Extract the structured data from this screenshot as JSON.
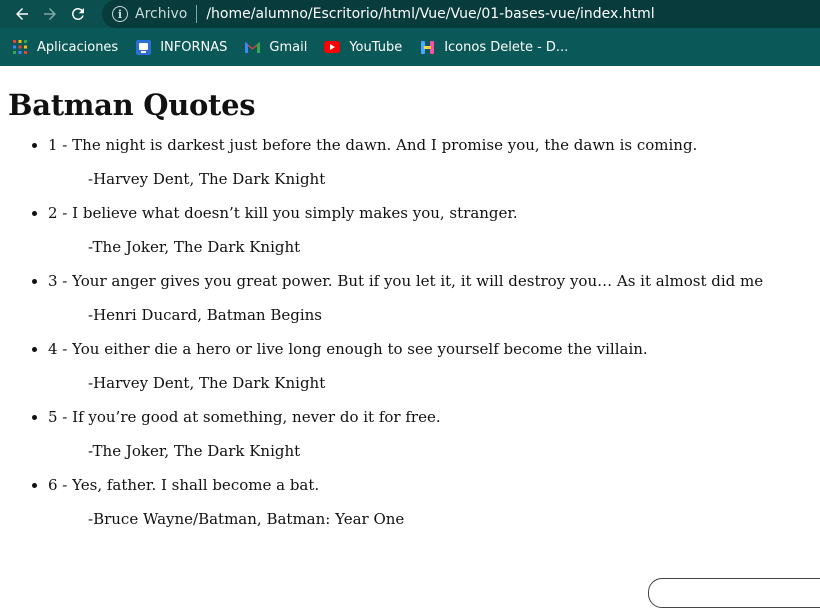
{
  "browser": {
    "archivo_label": "Archivo",
    "url": "/home/alumno/Escritorio/html/Vue/Vue/01-bases-vue/index.html",
    "bookmarks": [
      {
        "label": "Aplicaciones",
        "icon": "apps-grid-icon"
      },
      {
        "label": "INFORNAS",
        "icon": "infornas-icon"
      },
      {
        "label": "Gmail",
        "icon": "gmail-icon"
      },
      {
        "label": "YouTube",
        "icon": "youtube-icon"
      },
      {
        "label": "Iconos Delete - D...",
        "icon": "iconos-delete-icon"
      }
    ]
  },
  "page": {
    "title": "Batman Quotes",
    "quotes": [
      {
        "text": "1 - The night is darkest just before the dawn. And I promise you, the dawn is coming.",
        "author": "-Harvey Dent, The Dark Knight"
      },
      {
        "text": "2 - I believe what doesn’t kill you simply makes you, stranger.",
        "author": "-The Joker, The Dark Knight"
      },
      {
        "text": "3 - Your anger gives you great power. But if you let it, it will destroy you… As it almost did me",
        "author": "-Henri Ducard, Batman Begins"
      },
      {
        "text": "4 - You either die a hero or live long enough to see yourself become the villain.",
        "author": "-Harvey Dent, The Dark Knight"
      },
      {
        "text": "5 - If you’re good at something, never do it for free.",
        "author": "-The Joker, The Dark Knight"
      },
      {
        "text": "6 - Yes, father. I shall become a bat.",
        "author": "-Bruce Wayne/Batman, Batman: Year One"
      }
    ]
  },
  "colors": {
    "toolbar": "#0b4f4f",
    "bookmarks_bar": "#0b5858",
    "omnibox": "#083b3b"
  }
}
